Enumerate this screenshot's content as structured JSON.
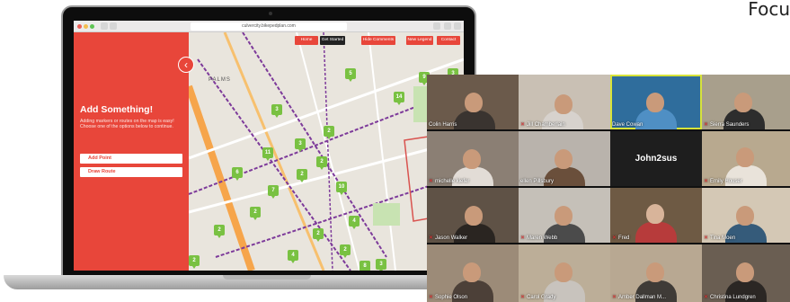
{
  "corner_text": "Focu",
  "browser": {
    "url": "culvercity.bikepedplan.com"
  },
  "app": {
    "nav": [
      "Home",
      "Get Started",
      "Hide Comments",
      "New Legend",
      "Contact"
    ],
    "panel": {
      "title": "Add Something!",
      "description": "Adding markers or routes on the map is easy! Choose one of the options below to continue.",
      "buttons": [
        "Add Point",
        "Draw Route"
      ]
    },
    "map_label": "PALMS",
    "markers": [
      "5",
      "9",
      "3",
      "14",
      "3",
      "2",
      "11",
      "2",
      "3",
      "6",
      "7",
      "2",
      "10",
      "2",
      "4",
      "2",
      "2",
      "2",
      "2",
      "4",
      "8",
      "3"
    ]
  },
  "zoom": {
    "center_name": "John2sus",
    "participants": [
      "Colin Harris",
      "Jill Chamberlain",
      "Dave Cowan",
      "Sierra Saunders",
      "michelle kiefer",
      "ellen Pillsbury",
      "Emily Houser",
      "Jason Walker",
      "Maren Webb",
      "Fred",
      "Tina Moen",
      "Sophie Olson",
      "Carol Grady",
      "Amber Dallman M...",
      "Christina Lundgren"
    ]
  },
  "colors": {
    "accent": "#e8463a",
    "marker": "#79c142",
    "active_speaker": "#d7e33a"
  }
}
